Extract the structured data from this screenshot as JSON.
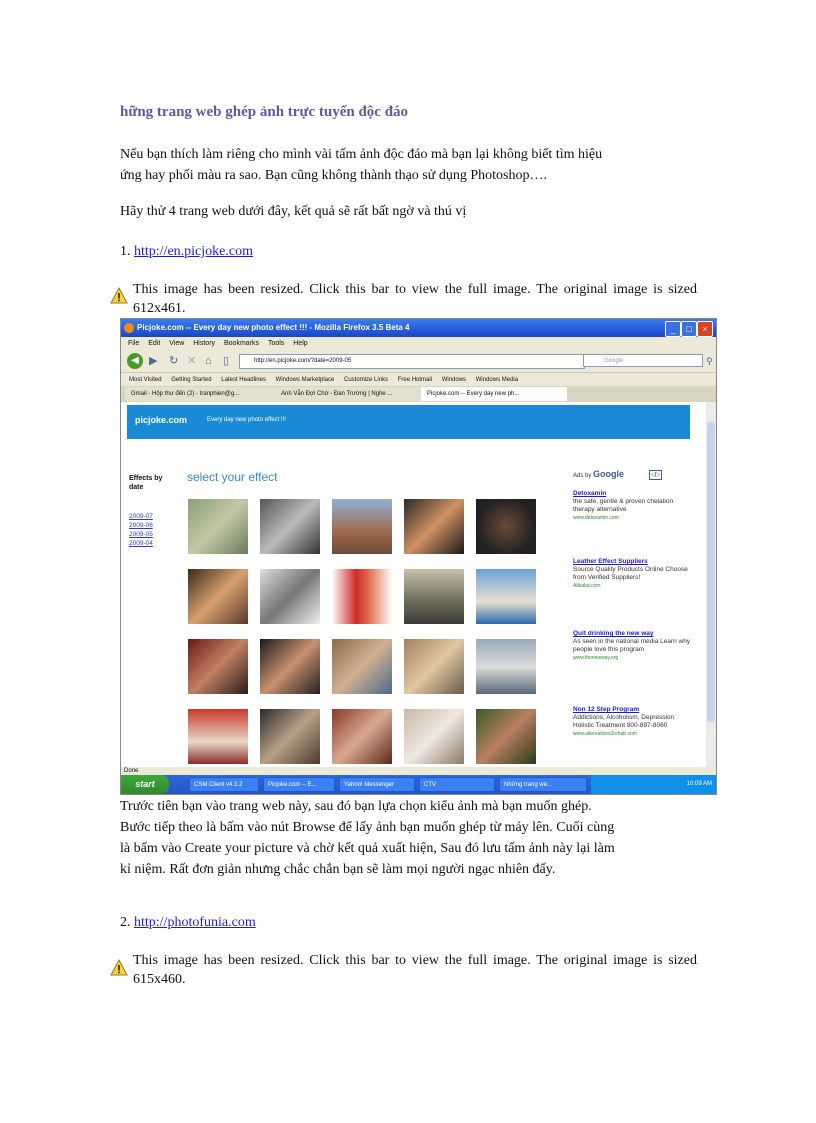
{
  "article": {
    "title": "hững trang web ghép ảnh trực tuyến độc đáo",
    "intro_line1": "Nếu bạn thích làm riêng cho mình vài tấm ảnh độc đáo mà bạn lại không biết tìm hiệu",
    "intro_line2": "ứng hay phối màu ra sao. Bạn cũng không thành thạo sử dụng Photoshop….",
    "try_line": "Hãy thử 4 trang web dưới đây, kết quả sẽ rất bất ngờ và thú vị",
    "item1_number": "1.",
    "item1_link": "http://en.picjoke.com",
    "notice1_text": "This image has been resized. Click this bar to view the full image. The original image is sized 612x461.",
    "desc_line1": "Trước tiên bạn vào trang web này, sau đó bạn lựa chọn kiểu ảnh mà bạn muốn ghép.",
    "desc_line2": "Bước tiếp theo là bấm vào nút Browse để lấy ảnh bạn muốn ghép từ máy lên. Cuối cùng",
    "desc_line3": "là bấm vào Create your picture và chờ kết quả xuất hiện, Sau đó lưu tấm ảnh này lại làm",
    "desc_line4": "kỉ niệm. Rất đơn giản nhưng chắc chắn bạn sẽ làm mọi người ngạc nhiên đấy.",
    "item2_number": "2.",
    "item2_link": "http://photofunia.com",
    "notice2_text": "This image has been resized. Click this bar to view the full image. The original image is sized 615x460."
  },
  "screenshot": {
    "window_title": "Picjoke.com -- Every day new photo effect !!! - Mozilla Firefox 3.5 Beta 4",
    "menu": [
      "File",
      "Edit",
      "View",
      "History",
      "Bookmarks",
      "Tools",
      "Help"
    ],
    "url": "http://en.picjoke.com/?date=2009-05",
    "search_placeholder": "Google",
    "bookmarks": [
      "Most Visited",
      "Getting Started",
      "Latest Headlines",
      "Windows Marketplace",
      "Customize Links",
      "Free Hotmail",
      "Windows",
      "Windows Media"
    ],
    "tabs": [
      "Gmail - Hộp thư đến (2) - tranphien@g...",
      "Anh Vẫn Đợi Chờ - Đan Trường | Nghe ...",
      "Picjoke.com -- Every day new ph..."
    ],
    "site_logo": "picjoke.com",
    "site_tagline": "Every day new photo effect !!!",
    "effects_label": "Effects by date",
    "dates": [
      "2009-07",
      "2009-06",
      "2009-05",
      "2009-04"
    ],
    "select_heading": "select your effect",
    "ads_by": "Ads by",
    "ads_google": "Google",
    "ads": [
      {
        "title": "Detoxamin",
        "body": "the safe, gentle & proven chelation therapy alternative",
        "url": "www.detoxamin.com"
      },
      {
        "title": "Leather Effect Suppliers",
        "body": "Source Quality Products Online Choose from Verified Suppliers!",
        "url": "Alibaba.com"
      },
      {
        "title": "Quit drinking the new way",
        "body": "As seen in the national media Learn why people love this program",
        "url": "www.thenewway.org"
      },
      {
        "title": "Non 12 Step Program",
        "body": "Addictions, Alcoholism, Depression Holistic Treatment 800-897-8060",
        "url": "www.alternatives2rehab.com"
      }
    ],
    "status": "Done",
    "start_label": "start",
    "taskbar_items": [
      "CSM Client v4.3.2",
      "Picjoke.com -- E...",
      "Yahoo! Messenger",
      "CTV",
      "Những trang we..."
    ],
    "clock": "10:09 AM"
  },
  "colors": {
    "title": "#5a5aa8",
    "link": "#1a1aee",
    "banner": "#1a8ad6"
  }
}
